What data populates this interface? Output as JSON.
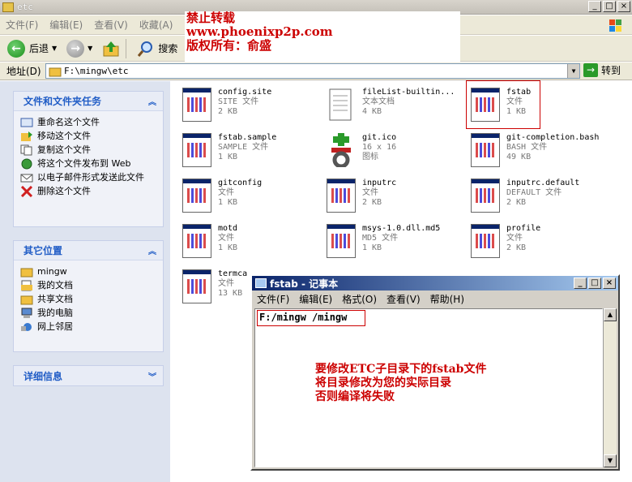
{
  "window": {
    "title": "etc"
  },
  "menu": [
    "文件(F)",
    "编辑(E)",
    "查看(V)",
    "收藏(A)"
  ],
  "toolbar": {
    "back": "后退",
    "search": "搜索"
  },
  "address": {
    "label": "地址(D)",
    "path": "F:\\mingw\\etc",
    "go": "转到"
  },
  "watermark": {
    "line1": "禁止转载",
    "line2": "www.phoenixp2p.com",
    "line3": "版权所有：俞盛"
  },
  "tasks": {
    "title": "文件和文件夹任务",
    "items": [
      "重命名这个文件",
      "移动这个文件",
      "复制这个文件",
      "将这个文件发布到 Web",
      "以电子邮件形式发送此文件",
      "删除这个文件"
    ]
  },
  "places": {
    "title": "其它位置",
    "items": [
      "mingw",
      "我的文档",
      "共享文档",
      "我的电脑",
      "网上邻居"
    ]
  },
  "details": {
    "title": "详细信息"
  },
  "files": [
    {
      "name": "config.site",
      "type": "SITE 文件",
      "size": "2 KB"
    },
    {
      "name": "fileList-builtin...",
      "type": "文本文档",
      "size": "4 KB"
    },
    {
      "name": "fstab",
      "type": "文件",
      "size": "1 KB"
    },
    {
      "name": "fstab.sample",
      "type": "SAMPLE 文件",
      "size": "1 KB"
    },
    {
      "name": "git.ico",
      "type": "16 x 16",
      "size": "图标"
    },
    {
      "name": "git-completion.bash",
      "type": "BASH 文件",
      "size": "49 KB"
    },
    {
      "name": "gitconfig",
      "type": "文件",
      "size": "1 KB"
    },
    {
      "name": "inputrc",
      "type": "文件",
      "size": "2 KB"
    },
    {
      "name": "inputrc.default",
      "type": "DEFAULT 文件",
      "size": "2 KB"
    },
    {
      "name": "motd",
      "type": "文件",
      "size": "1 KB"
    },
    {
      "name": "msys-1.0.dll.md5",
      "type": "MD5 文件",
      "size": "1 KB"
    },
    {
      "name": "profile",
      "type": "文件",
      "size": "2 KB"
    },
    {
      "name": "termca",
      "type": "文件",
      "size": "13 KB"
    }
  ],
  "notepad": {
    "title": "fstab - 记事本",
    "menu": [
      "文件(F)",
      "编辑(E)",
      "格式(O)",
      "查看(V)",
      "帮助(H)"
    ],
    "content": "F:/mingw /mingw",
    "note1": "要修改ETC子目录下的fstab文件",
    "note2": "将目录修改为您的实际目录",
    "note3": "否则编译将失败"
  }
}
